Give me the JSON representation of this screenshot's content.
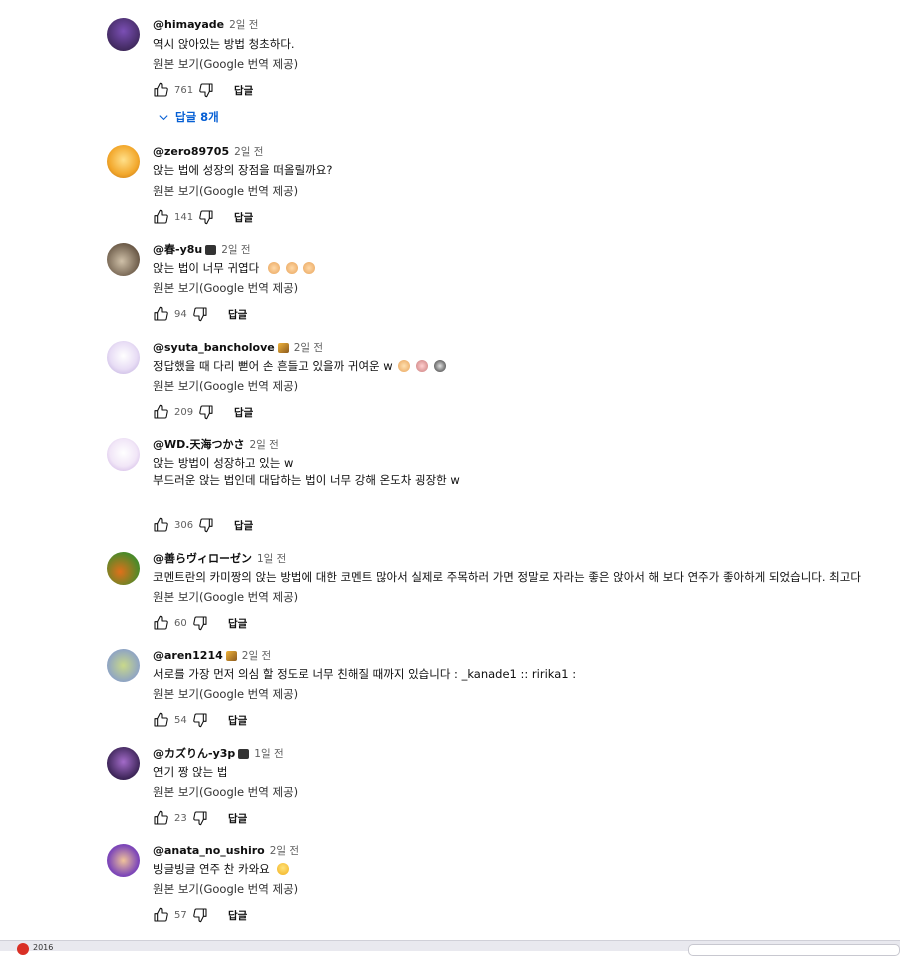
{
  "reply_label": "답글",
  "translate_label": "원본 보기(Google 번역 제공)",
  "comments": [
    {
      "author": "@himayade",
      "time": "2일 전",
      "lines": [
        "역시 앉아있는 방법 청초하다."
      ],
      "likes": "761",
      "replies_label": "답글 8개",
      "avatar_colors": [
        "#2a1b3d",
        "#7b4fb5"
      ]
    },
    {
      "author": "@zero89705",
      "time": "2일 전",
      "lines": [
        "앉는 법에 성장의 장점을 떠올릴까요?"
      ],
      "likes": "141",
      "avatar_colors": [
        "#f2a72b",
        "#ffe08a"
      ]
    },
    {
      "author": "@春-y8u",
      "time": "2일 전",
      "lines": [
        "앉는 법이 너무 귀엽다"
      ],
      "likes": "94",
      "avatar_colors": [
        "#6b5a48",
        "#cfc0a8"
      ]
    },
    {
      "author": "@syuta_bancholove",
      "time": "2일 전",
      "lines": [
        "정답했을 때 다리 뻗어 손 흔들고 있을까 귀여운 w"
      ],
      "likes": "209",
      "avatar_colors": [
        "#e8ddf5",
        "#b9a7da"
      ]
    },
    {
      "author": "@WD.天海つかさ",
      "time": "2일 전",
      "lines": [
        "앉는 방법이 성장하고 있는 w",
        "부드러운 앉는 법인데 대답하는 법이 너무 강해 온도차 굉장한 w"
      ],
      "likes": "306",
      "avatar_colors": [
        "#f1e6f7",
        "#c7a9e0"
      ]
    },
    {
      "author": "@善らヴィローゼン",
      "time": "1일 전",
      "lines": [
        "코멘트란의 카미짱의 앉는 방법에 대한 코멘트 많아서 실제로 주목하러 가면 정말로 자라는 좋은 앉아서 해 보다 연주가 좋아하게 되었습니다. 최고다"
      ],
      "likes": "60",
      "avatar_colors": [
        "#e0701a",
        "#4a8a2a"
      ]
    },
    {
      "author": "@aren1214",
      "time": "2일 전",
      "lines": [
        "서로를 가장 먼저 의심 할 정도로 너무 친해질 때까지 있습니다 : _kanade1 :: ririka1 :"
      ],
      "likes": "54",
      "avatar_colors": [
        "#c9d98a",
        "#8aa0c8"
      ]
    },
    {
      "author": "@カズりん-y3p",
      "time": "1일 전",
      "lines": [
        "연기 짱 앉는 법"
      ],
      "likes": "23",
      "avatar_colors": [
        "#3b2456",
        "#a36bc9"
      ]
    },
    {
      "author": "@anata_no_ushiro",
      "time": "2일 전",
      "lines": [
        "빙글빙글 연주 찬 카와요"
      ],
      "likes": "57",
      "avatar_colors": [
        "#7d47b8",
        "#f0c39a"
      ]
    }
  ],
  "taskbar": {
    "app_text": "2016"
  }
}
